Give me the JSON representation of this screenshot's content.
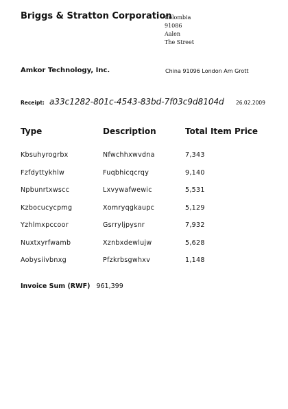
{
  "sender": {
    "name": "Briggs & Stratton Corporation",
    "address": [
      "Colombia",
      "91086",
      "Aalen",
      "The Street"
    ]
  },
  "recipient": {
    "name": "Amkor Technology, Inc.",
    "address": "China 91096 London Am Grott"
  },
  "receipt": {
    "label": "Receipt:",
    "id": "a33c1282-801c-4543-83bd-7f03c9d8104d",
    "date": "26.02.2009"
  },
  "table": {
    "headers": {
      "type": "Type",
      "description": "Description",
      "price": "Total Item Price"
    },
    "rows": [
      {
        "type": "Kbsuhyrogrbx",
        "description": "Nfwchhxwvdna",
        "price": "7,343"
      },
      {
        "type": "Fzfdyttykhlw",
        "description": "Fuqbhicqcrqy",
        "price": "9,140"
      },
      {
        "type": "Npbunrtxwscc",
        "description": "Lxvywafwewic",
        "price": "5,531"
      },
      {
        "type": "Kzbocucycpmg",
        "description": "Xomryqgkaupc",
        "price": "5,129"
      },
      {
        "type": "Yzhlmxpccoor",
        "description": "Gsrryljpysnr",
        "price": "7,932"
      },
      {
        "type": "Nuxtxyrfwamb",
        "description": "Xznbxdewlujw",
        "price": "5,628"
      },
      {
        "type": "Aobysiivbnxg",
        "description": "Pfzkrbsgwhxv",
        "price": "1,148"
      }
    ]
  },
  "total": {
    "label": "Invoice Sum (RWF)",
    "value": "961,399"
  }
}
